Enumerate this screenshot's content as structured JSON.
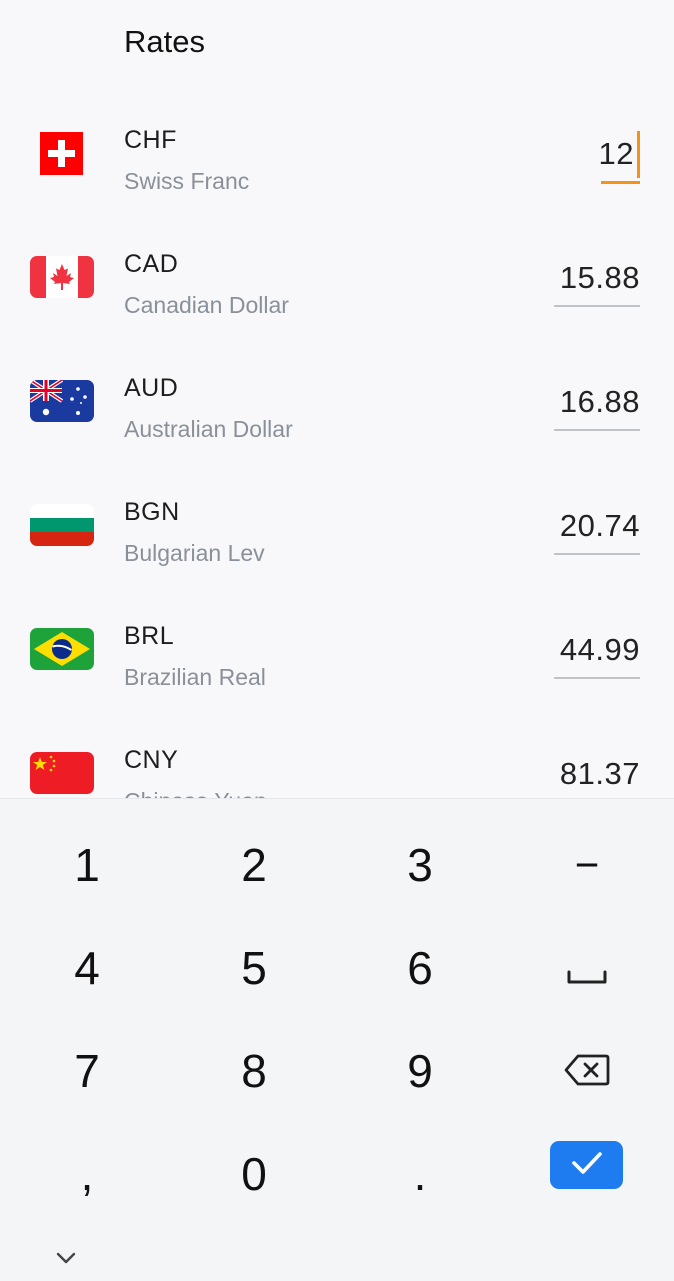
{
  "header": {
    "title": "Rates"
  },
  "rates": [
    {
      "code": "CHF",
      "name": "Swiss Franc",
      "value": "12",
      "flag_icon": "swiss-flag-icon",
      "active": true
    },
    {
      "code": "CAD",
      "name": "Canadian Dollar",
      "value": "15.88",
      "flag_icon": "canada-flag-icon"
    },
    {
      "code": "AUD",
      "name": "Australian Dollar",
      "value": "16.88",
      "flag_icon": "australia-flag-icon"
    },
    {
      "code": "BGN",
      "name": "Bulgarian Lev",
      "value": "20.74",
      "flag_icon": "bulgaria-flag-icon"
    },
    {
      "code": "BRL",
      "name": "Brazilian Real",
      "value": "44.99",
      "flag_icon": "brazil-flag-icon"
    },
    {
      "code": "CNY",
      "name": "Chinese Yuan",
      "value": "81.37",
      "flag_icon": "china-flag-icon"
    }
  ],
  "keyboard": {
    "keys": [
      "1",
      "2",
      "3",
      "−",
      "4",
      "5",
      "6",
      "␣",
      "7",
      "8",
      "9",
      "⌫",
      ",",
      "0",
      ".",
      "✓"
    ],
    "icons": {
      "space": "space-icon",
      "backspace": "backspace-icon",
      "done": "check-icon",
      "collapse": "chevron-down-icon"
    }
  },
  "colors": {
    "accent": "#f29318",
    "done": "#1f7cf0",
    "secondary_text": "#8a9099"
  }
}
